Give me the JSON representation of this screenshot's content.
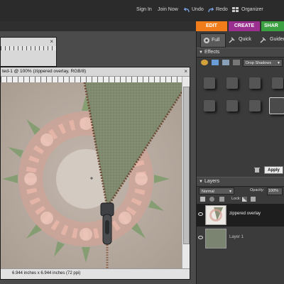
{
  "header": {
    "sign_in": "Sign In",
    "join_now": "Join Now",
    "undo": "Undo",
    "redo": "Redo",
    "organizer": "Organizer"
  },
  "mode_tabs": [
    {
      "label": "EDIT",
      "color": "#f07d1a"
    },
    {
      "label": "CREATE",
      "color": "#9a2f8f"
    },
    {
      "label": "SHAR",
      "color": "#3aa041"
    }
  ],
  "edit_modes": {
    "full": "Full",
    "quick": "Quick",
    "guided": "Guided"
  },
  "document": {
    "title": "ted-1 @ 100% (zippered overlay, RGB/8)",
    "status": "6.944 inches x 6.944 inches (72 ppi)"
  },
  "effects": {
    "title": "Effects",
    "category": "Drop Shadows",
    "apply": "Apply"
  },
  "layers": {
    "title": "Layers",
    "blend_mode": "Normal",
    "opacity_label": "Opacity:",
    "opacity_value": "100%",
    "lock_label": "Lock:",
    "items": [
      {
        "name": "zippered overlay",
        "selected": true
      },
      {
        "name": "Layer 1",
        "selected": false
      }
    ]
  },
  "colors": {
    "accent_edit": "#f07d1a",
    "accent_create": "#9a2f8f",
    "accent_share": "#3aa041",
    "panel_bg": "#3b3b3b",
    "artwork_bg": "#b9aea4",
    "zipper_fabric": "#7f8a6f"
  }
}
